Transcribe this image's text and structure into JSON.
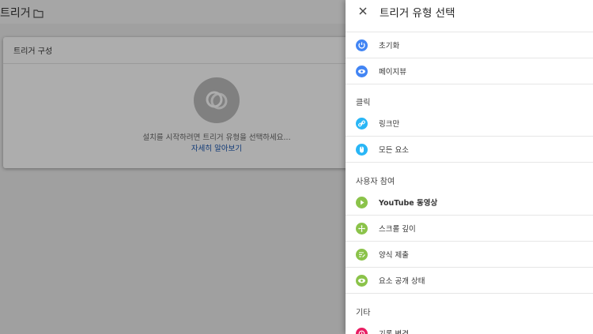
{
  "background": {
    "title": "트리거",
    "card_title": "트리거 구성",
    "placeholder_text": "설치를 시작하려면 트리거 유형을 선택하세요...",
    "learn_more": "자세히 알아보기"
  },
  "panel": {
    "title": "트리거 유형 선택",
    "colors": {
      "blue": "#4285f4",
      "lightblue": "#29b6f6",
      "green": "#8bc34a",
      "pink": "#e91e63"
    },
    "groups": [
      {
        "label": "",
        "items": [
          "초기화",
          "페이지뷰"
        ]
      },
      {
        "label": "클릭",
        "items": [
          "링크만",
          "모든 요소"
        ]
      },
      {
        "label": "사용자 참여",
        "items": [
          "YouTube 동영상",
          "스크롤 깊이",
          "양식 제출",
          "요소 공개 상태"
        ]
      },
      {
        "label": "기타",
        "items": [
          "기록 변경"
        ]
      }
    ]
  }
}
